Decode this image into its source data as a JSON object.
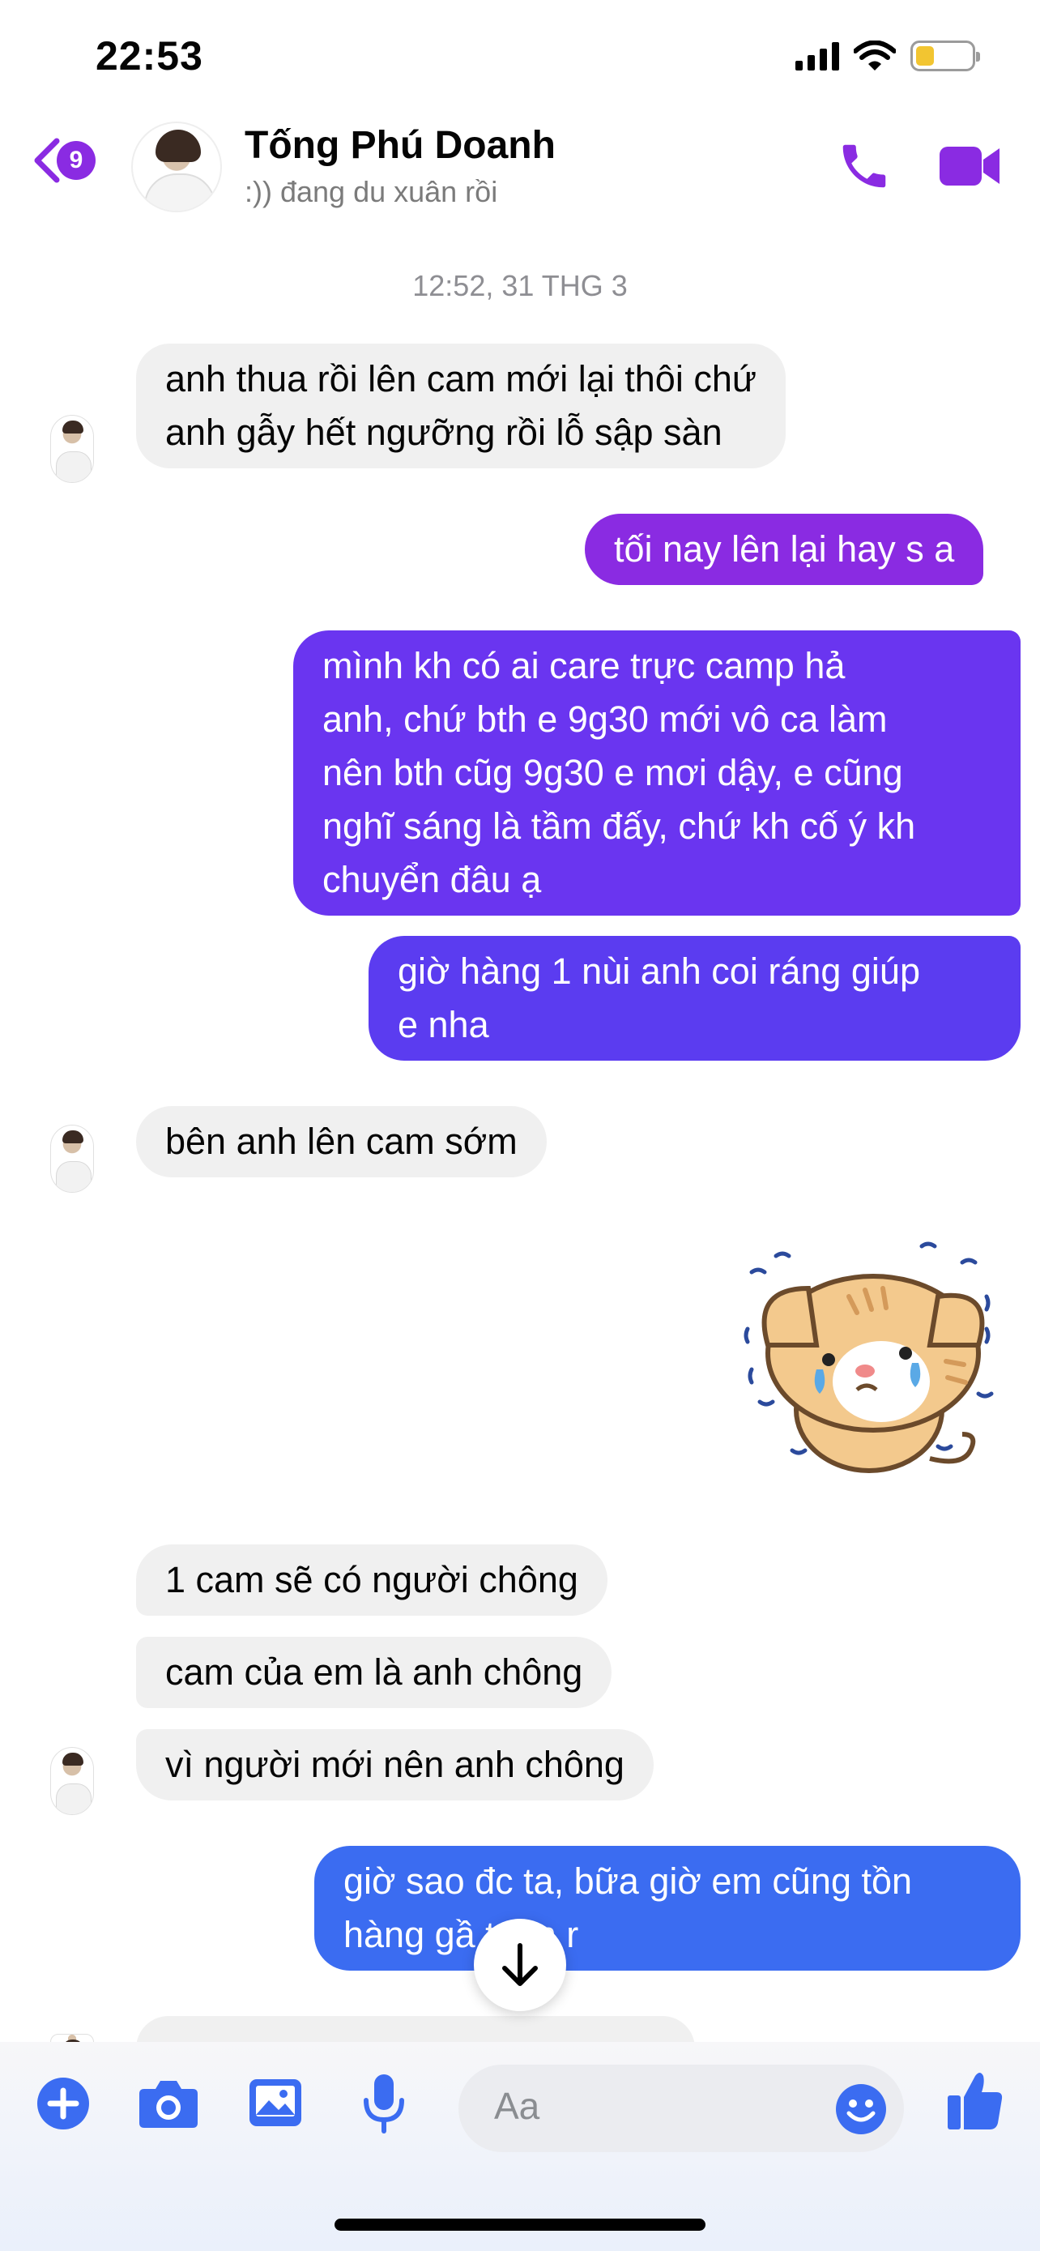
{
  "status_bar": {
    "time": "22:53"
  },
  "header": {
    "unread_count": "9",
    "contact_name": "Tống Phú Doanh",
    "contact_status": ":)) đang du xuân rồi"
  },
  "thread": {
    "timestamp": "12:52, 31 THG 3",
    "messages": [
      {
        "from": "contact",
        "lines": [
          "anh thua rồi lên cam mới lại thôi chứ",
          "anh gẫy hết ngưỡng rồi lỗ sập sàn"
        ]
      },
      {
        "from": "me",
        "lines": [
          "tối nay lên lại hay s a"
        ]
      },
      {
        "from": "me",
        "lines": [
          "mình kh có ai care trực camp hả",
          "anh, chứ bth e 9g30 mới vô ca làm",
          "nên bth cũg 9g30 e mơi dậy, e cũng",
          "nghĩ sáng là tầm đấy, chứ kh cố ý kh",
          "chuyển đâu ạ"
        ]
      },
      {
        "from": "me",
        "lines": [
          "giờ hàng 1 nùi anh coi ráng giúp",
          "e nha"
        ]
      },
      {
        "from": "contact",
        "lines": [
          "bên anh lên cam sớm"
        ]
      },
      {
        "from": "me",
        "sticker": "crying-cat-sticker"
      },
      {
        "from": "contact",
        "lines": [
          "1 cam sẽ có người chông"
        ]
      },
      {
        "from": "contact",
        "lines": [
          "cam của em là anh chông"
        ]
      },
      {
        "from": "contact",
        "lines": [
          "vì người mới nên anh chông"
        ]
      },
      {
        "from": "me",
        "lines": [
          "giờ sao đc ta, bữa giờ em cũng tồn",
          "hàng gầ    tuần r"
        ]
      }
    ]
  },
  "composer": {
    "placeholder": "Aa"
  },
  "colors": {
    "accent": "#8a2be2",
    "bubble_purple": "#6a35f0",
    "bubble_blue": "#3b6cf1",
    "incoming": "#f0f0f0"
  },
  "icons": [
    "back-chevron-icon",
    "phone-icon",
    "video-icon",
    "plus-icon",
    "camera-icon",
    "image-icon",
    "mic-icon",
    "emoji-icon",
    "thumbs-up-icon",
    "arrow-down-icon"
  ]
}
